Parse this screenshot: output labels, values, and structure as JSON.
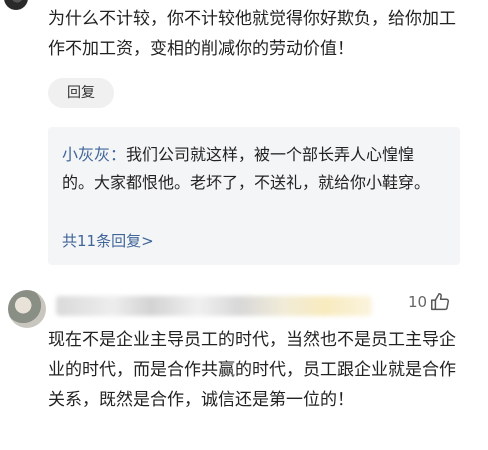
{
  "comments": [
    {
      "text": "为什么不计较，你不计较他就觉得你好欺负，给你加工作不加工资，变相的削减你的劳动价值！",
      "reply_button": "回复",
      "replies_preview": {
        "user": "小灰灰",
        "separator": "：",
        "text": "我们公司就这样，被一个部长弄人心惶惶的。大家都恨他。老坏了，不送礼，就给你小鞋穿。",
        "more_label": "共11条回复>"
      }
    },
    {
      "likes": "10",
      "text": "现在不是企业主导员工的时代，当然也不是员工主导企业的时代，而是合作共赢的时代，员工跟企业就是合作关系，既然是合作，诚信还是第一位的！"
    }
  ],
  "icons": {
    "like": "thumbs-up-icon"
  },
  "colors": {
    "link": "#406599",
    "reply_bg": "#f4f5f7"
  }
}
